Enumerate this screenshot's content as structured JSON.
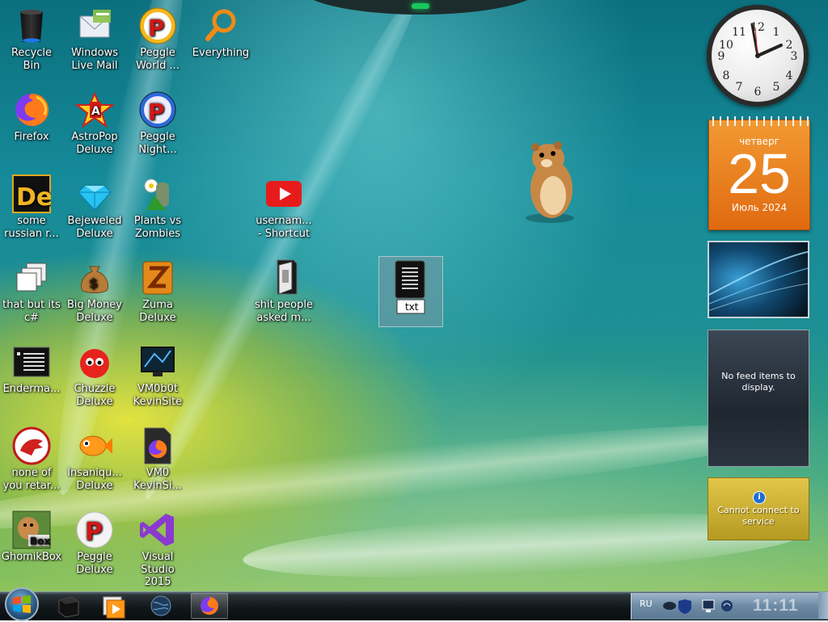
{
  "desktop_icons": [
    {
      "label": "Recycle\nBin",
      "icon": "recycle-bin-icon"
    },
    {
      "label": "Windows\nLive Mail",
      "icon": "mail-icon"
    },
    {
      "label": "Peggle\nWorld ...",
      "icon": "peggle-icon"
    },
    {
      "label": "Everything",
      "icon": "magnifier-icon"
    },
    {
      "label": "Firefox",
      "icon": "firefox-icon"
    },
    {
      "label": "AstroPop\nDeluxe",
      "icon": "astropop-icon"
    },
    {
      "label": "Peggle\nNight...",
      "icon": "peggle-night-icon"
    },
    {
      "label": "some\nrussian r...",
      "icon": "de-icon"
    },
    {
      "label": "Bejeweled\nDeluxe",
      "icon": "gem-icon"
    },
    {
      "label": "Plants vs\nZombies",
      "icon": "plant-icon"
    },
    {
      "label": "usernam...\n- Shortcut",
      "icon": "youtube-icon"
    },
    {
      "label": "that but its\nc#",
      "icon": "stacked-windows-icon"
    },
    {
      "label": "Big Money\nDeluxe",
      "icon": "money-bag-icon"
    },
    {
      "label": "Zuma\nDeluxe",
      "icon": "zuma-icon"
    },
    {
      "label": "shit people\nasked m...",
      "icon": "folder-icon"
    },
    {
      "label": "Enderma...",
      "icon": "text-window-icon"
    },
    {
      "label": "Chuzzle\nDeluxe",
      "icon": "chuzzle-icon"
    },
    {
      "label": "VM0b0t\nKevinSite",
      "icon": "monitor-icon"
    },
    {
      "label": "none of\nyou retar...",
      "icon": "dino-icon"
    },
    {
      "label": "Insaniqu...\nDeluxe",
      "icon": "fish-icon"
    },
    {
      "label": "VM0\nKevinSi...",
      "icon": "firefox-file-icon"
    },
    {
      "label": "GhomikBox",
      "icon": "hamster-box-icon"
    },
    {
      "label": "Peggle\nDeluxe",
      "icon": "peggle-deluxe-icon"
    },
    {
      "label": "Visual\nStudio 2015",
      "icon": "visual-studio-icon"
    }
  ],
  "selected_file": {
    "badge": "txt"
  },
  "gadgets": {
    "calendar": {
      "day_of_week": "четверг",
      "day": "25",
      "month_year": "Июль 2024"
    },
    "feed": {
      "message": "No feed items to display."
    },
    "weather": {
      "info_glyph": "i",
      "message": "Cannot connect to service"
    },
    "clock": {
      "numerals": [
        "12",
        "1",
        "2",
        "3",
        "4",
        "5",
        "6",
        "7",
        "8",
        "9",
        "10",
        "11"
      ]
    }
  },
  "taskbar": {
    "pinned": [
      "black-cube-icon",
      "media-player-icon",
      "globe-icon",
      "firefox-icon"
    ],
    "active_index": 3
  },
  "tray": {
    "language": "RU",
    "time": "11:11",
    "icons": [
      "chat-icon",
      "shield-icon",
      "monitor-icon",
      "network-icon"
    ]
  },
  "colors": {
    "accent_green": "#19c75c",
    "calendar_orange": "#e06a10",
    "weather_gold": "#c9ac32"
  }
}
